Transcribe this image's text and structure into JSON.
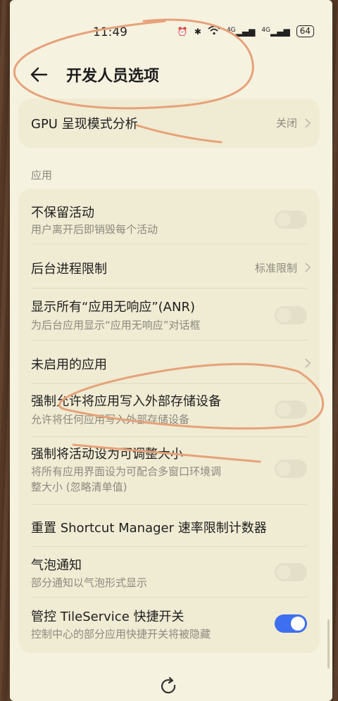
{
  "status": {
    "time": "11:49",
    "network1": "4G",
    "network2": "4G",
    "battery": "64"
  },
  "header": {
    "title": "开发人员选项"
  },
  "gpu": {
    "label": "GPU 呈现模式分析",
    "value": "关闭"
  },
  "section": {
    "title": "应用"
  },
  "items": [
    {
      "label": "不保留活动",
      "sub": "用户离开后即销毁每个活动",
      "toggle": false
    },
    {
      "label": "后台进程限制",
      "value": "标准限制"
    },
    {
      "label": "显示所有“应用无响应”(ANR)",
      "sub": "为后台应用显示“应用无响应”对话框",
      "toggle": false
    },
    {
      "label": "未启用的应用"
    },
    {
      "label": "强制允许将应用写入外部存储设备",
      "sub": "允许将任何应用写入外部存储设备",
      "toggle": false
    },
    {
      "label": "强制将活动设为可调整大小",
      "sub": "将所有应用界面设为可配合多窗口环境调",
      "sub2": "整大小 (忽略清单值)",
      "toggle": false
    },
    {
      "label": "重置 Shortcut Manager 速率限制计数器"
    },
    {
      "label": "气泡通知",
      "sub": "部分通知以气泡形式显示",
      "toggle": false
    },
    {
      "label": "管控 TileService 快捷开关",
      "sub": "控制中心的部分应用快捷开关将被隐藏",
      "toggle": true
    }
  ],
  "colors": {
    "accent": "#3d6ff0",
    "annotation": "#e6a27a",
    "background": "#f6f2e0"
  }
}
